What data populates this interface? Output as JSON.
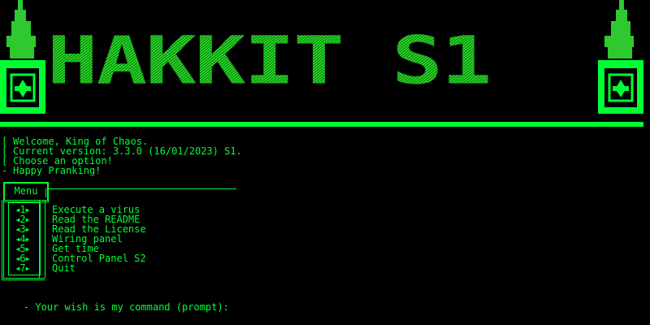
{
  "banner": {
    "title": "HAKKIT S1",
    "left_icon": "lantern-icon",
    "right_icon": "lantern-icon"
  },
  "info": {
    "lines": [
      "Welcome, King of Chaos.",
      "Current version: 3.3.0 (16/01/2023) S1.",
      "Choose an option!",
      "Happy Pranking!"
    ]
  },
  "menu": {
    "title": "Menu",
    "items": [
      {
        "key": "1",
        "label": "Execute a virus"
      },
      {
        "key": "2",
        "label": "Read the README"
      },
      {
        "key": "3",
        "label": "Read the License"
      },
      {
        "key": "4",
        "label": "Wiring panel"
      },
      {
        "key": "5",
        "label": "Get time"
      },
      {
        "key": "6",
        "label": "Control Panel S2"
      },
      {
        "key": "7",
        "label": "Quit"
      }
    ]
  },
  "prompt": {
    "text": "- Your wish is my command (prompt):",
    "value": ""
  },
  "colors": {
    "foreground": "#00ff33",
    "background": "#000000",
    "banner_dark": "#0f8f0f"
  }
}
